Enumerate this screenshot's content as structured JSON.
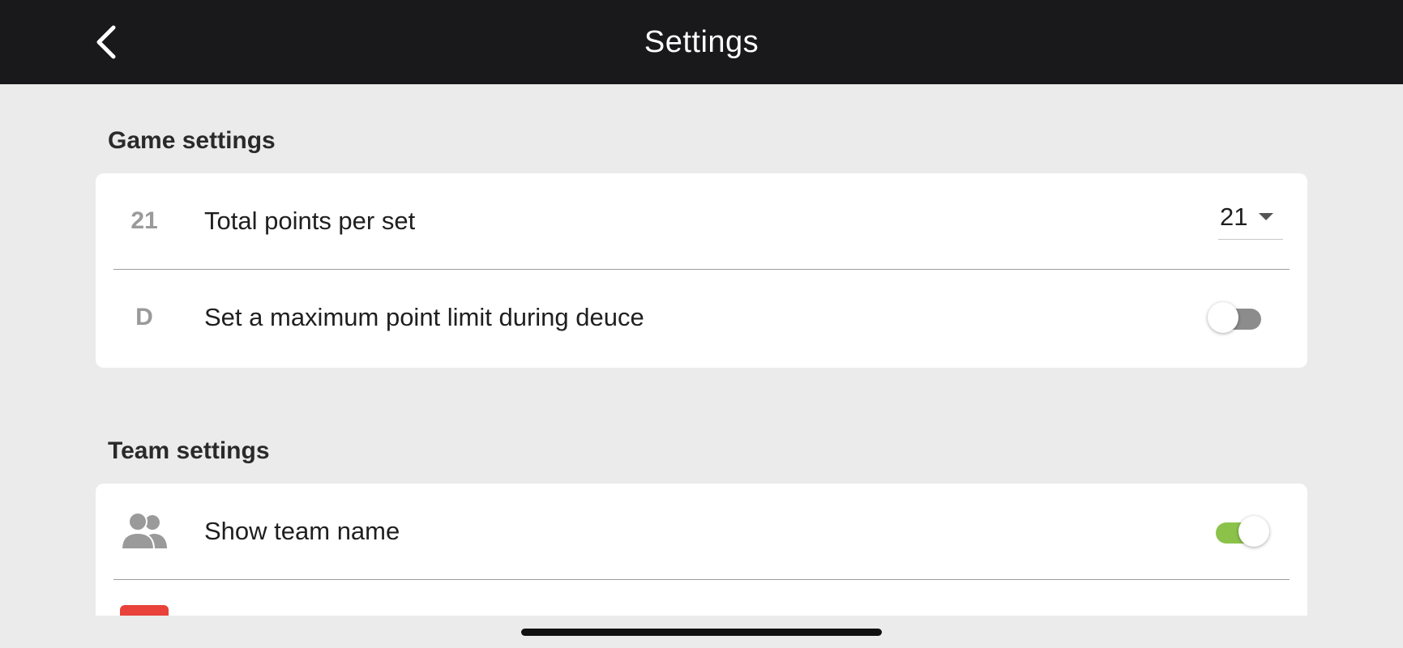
{
  "header": {
    "title": "Settings",
    "back_icon": "chevron-left-icon",
    "background": "#19191b"
  },
  "game_settings": {
    "title": "Game settings",
    "items": [
      {
        "icon_text": "21",
        "label": "Total points per set",
        "control": "select",
        "value": "21",
        "dropdown_icon": "caret-down-icon"
      },
      {
        "icon_text": "D",
        "label": "Set a maximum point limit during deuce",
        "control": "toggle",
        "enabled": false,
        "track_color": "#8c8c8c"
      }
    ]
  },
  "team_settings": {
    "title": "Team settings",
    "items": [
      {
        "icon": "people-icon",
        "label": "Show team name",
        "control": "toggle",
        "enabled": true,
        "track_color": "#8bc34a"
      },
      {
        "icon": "color-swatch-icon",
        "swatch_color": "#e8423a"
      }
    ]
  }
}
